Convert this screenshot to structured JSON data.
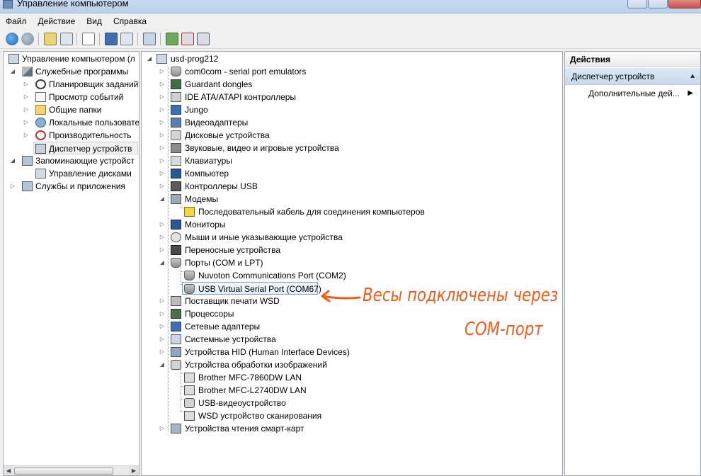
{
  "window": {
    "title": "Управление компьютером"
  },
  "menu": [
    {
      "label": "Файл"
    },
    {
      "label": "Действие"
    },
    {
      "label": "Вид"
    },
    {
      "label": "Справка"
    }
  ],
  "left_tree": {
    "root": "Управление компьютером (л",
    "items": [
      {
        "label": "Служебные программы"
      },
      {
        "label": "Планировщик заданий"
      },
      {
        "label": "Просмотр событий"
      },
      {
        "label": "Общие папки"
      },
      {
        "label": "Локальные пользовате"
      },
      {
        "label": "Производительность"
      },
      {
        "label": "Диспетчер устройств"
      },
      {
        "label": "Запоминающие устройст"
      },
      {
        "label": "Управление дисками"
      },
      {
        "label": "Службы и приложения"
      }
    ]
  },
  "device_tree": {
    "root": "usd-prog212",
    "items": [
      {
        "label": "com0com - serial port emulators"
      },
      {
        "label": "Guardant dongles"
      },
      {
        "label": "IDE ATA/ATAPI контроллеры"
      },
      {
        "label": "Jungo"
      },
      {
        "label": "Видеоадаптеры"
      },
      {
        "label": "Дисковые устройства"
      },
      {
        "label": "Звуковые, видео и игровые устройства"
      },
      {
        "label": "Клавиатуры"
      },
      {
        "label": "Компьютер"
      },
      {
        "label": "Контроллеры USB"
      },
      {
        "label": "Модемы"
      },
      {
        "label": "Последовательный кабель для соединения компьютеров"
      },
      {
        "label": "Мониторы"
      },
      {
        "label": "Мыши и иные указывающие устройства"
      },
      {
        "label": "Переносные устройства"
      },
      {
        "label": "Порты (COM и LPT)"
      },
      {
        "label": "Nuvoton Communications Port (COM2)"
      },
      {
        "label": "USB Virtual Serial Port (COM67)"
      },
      {
        "label": "Поставщик печати WSD"
      },
      {
        "label": "Процессоры"
      },
      {
        "label": "Сетевые адаптеры"
      },
      {
        "label": "Системные устройства"
      },
      {
        "label": "Устройства HID (Human Interface Devices)"
      },
      {
        "label": "Устройства обработки изображений"
      },
      {
        "label": "Brother MFC-7860DW LAN"
      },
      {
        "label": "Brother MFC-L2740DW LAN"
      },
      {
        "label": "USB-видеоустройство"
      },
      {
        "label": "WSD устройство сканирования"
      },
      {
        "label": "Устройства чтения смарт-карт"
      }
    ]
  },
  "actions": {
    "header": "Действия",
    "section": "Диспетчер устройств",
    "item": "Дополнительные дей..."
  },
  "annotation": {
    "line1": "Весы подключены через",
    "line2": "COM-порт",
    "color": "#f35a18"
  }
}
